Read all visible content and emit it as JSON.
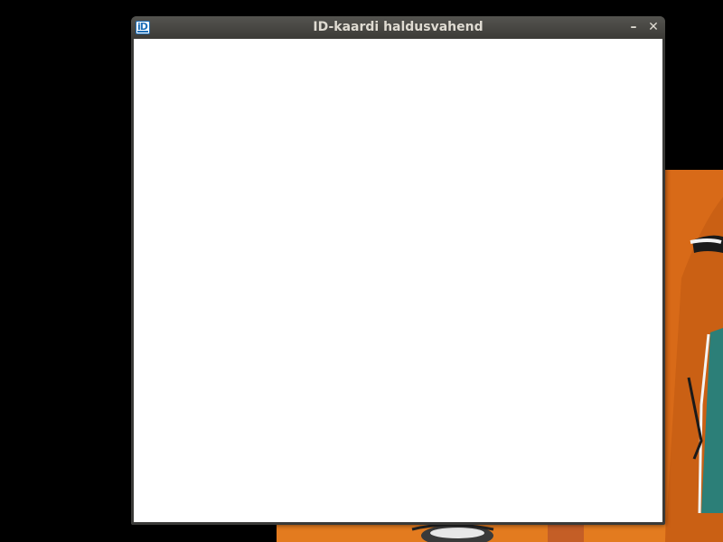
{
  "window": {
    "title": "ID-kaardi haldusvahend",
    "app_icon": "id-card-icon",
    "minimize_glyph": "–",
    "close_glyph": "✕"
  },
  "colors": {
    "desktop": "#000000",
    "titlebar": "#3c3b37",
    "title_text": "#dfdbd2",
    "content": "#ffffff",
    "wallpaper_accent": "#e07a1e"
  }
}
